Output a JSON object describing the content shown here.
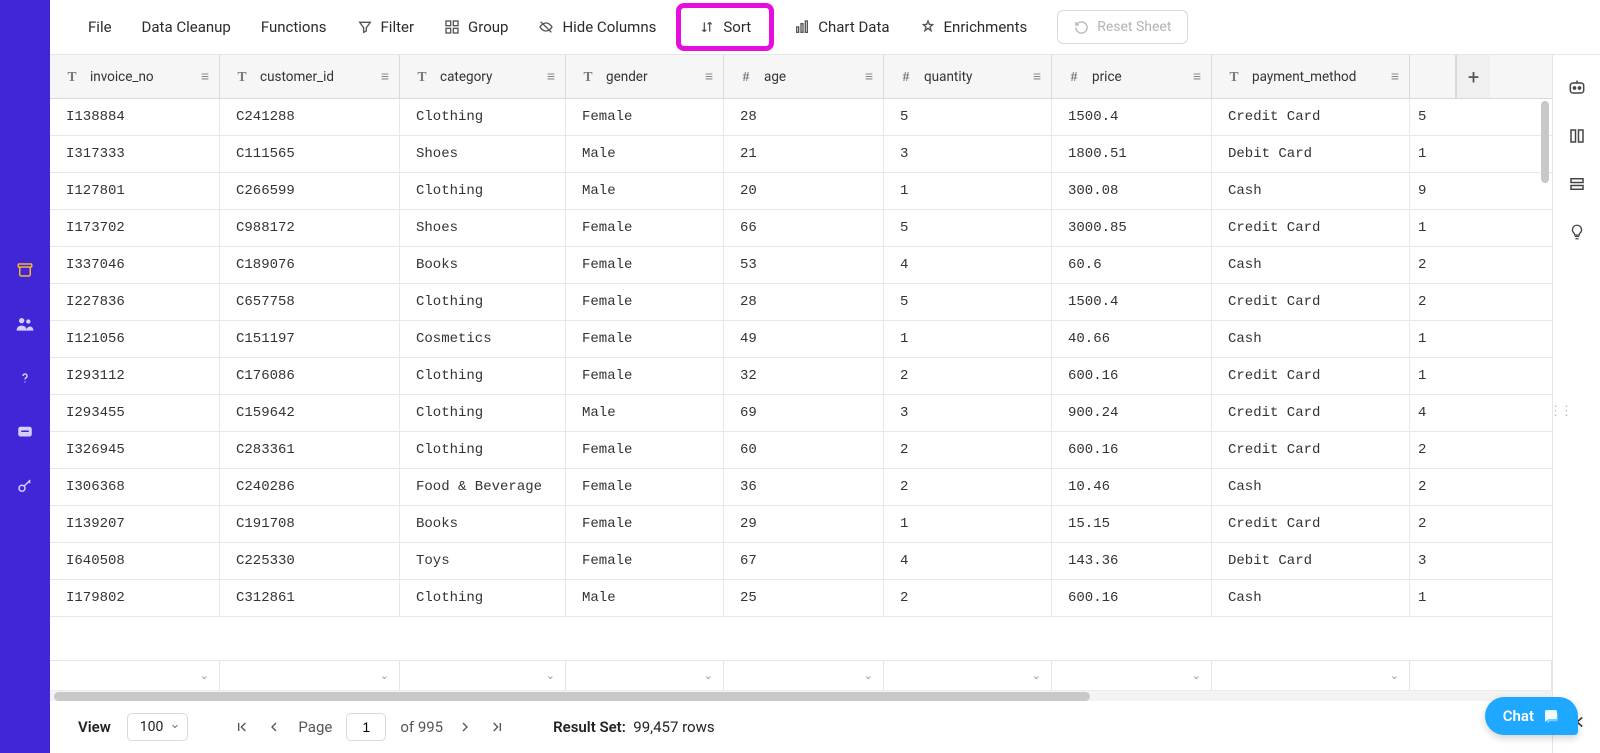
{
  "toolbar": {
    "file": "File",
    "data_cleanup": "Data Cleanup",
    "functions": "Functions",
    "filter": "Filter",
    "group": "Group",
    "hide_columns": "Hide Columns",
    "sort": "Sort",
    "chart_data": "Chart Data",
    "enrichments": "Enrichments",
    "reset_sheet": "Reset Sheet"
  },
  "columns": [
    {
      "name": "invoice_no",
      "type": "text"
    },
    {
      "name": "customer_id",
      "type": "text"
    },
    {
      "name": "category",
      "type": "text"
    },
    {
      "name": "gender",
      "type": "text"
    },
    {
      "name": "age",
      "type": "number"
    },
    {
      "name": "quantity",
      "type": "number"
    },
    {
      "name": "price",
      "type": "number"
    },
    {
      "name": "payment_method",
      "type": "text"
    }
  ],
  "rows": [
    {
      "invoice_no": "I138884",
      "customer_id": "C241288",
      "category": "Clothing",
      "gender": "Female",
      "age": "28",
      "quantity": "5",
      "price": "1500.4",
      "payment_method": "Credit Card",
      "extra": "5"
    },
    {
      "invoice_no": "I317333",
      "customer_id": "C111565",
      "category": "Shoes",
      "gender": "Male",
      "age": "21",
      "quantity": "3",
      "price": "1800.51",
      "payment_method": "Debit Card",
      "extra": "1"
    },
    {
      "invoice_no": "I127801",
      "customer_id": "C266599",
      "category": "Clothing",
      "gender": "Male",
      "age": "20",
      "quantity": "1",
      "price": "300.08",
      "payment_method": "Cash",
      "extra": "9"
    },
    {
      "invoice_no": "I173702",
      "customer_id": "C988172",
      "category": "Shoes",
      "gender": "Female",
      "age": "66",
      "quantity": "5",
      "price": "3000.85",
      "payment_method": "Credit Card",
      "extra": "1"
    },
    {
      "invoice_no": "I337046",
      "customer_id": "C189076",
      "category": "Books",
      "gender": "Female",
      "age": "53",
      "quantity": "4",
      "price": "60.6",
      "payment_method": "Cash",
      "extra": "2"
    },
    {
      "invoice_no": "I227836",
      "customer_id": "C657758",
      "category": "Clothing",
      "gender": "Female",
      "age": "28",
      "quantity": "5",
      "price": "1500.4",
      "payment_method": "Credit Card",
      "extra": "2"
    },
    {
      "invoice_no": "I121056",
      "customer_id": "C151197",
      "category": "Cosmetics",
      "gender": "Female",
      "age": "49",
      "quantity": "1",
      "price": "40.66",
      "payment_method": "Cash",
      "extra": "1"
    },
    {
      "invoice_no": "I293112",
      "customer_id": "C176086",
      "category": "Clothing",
      "gender": "Female",
      "age": "32",
      "quantity": "2",
      "price": "600.16",
      "payment_method": "Credit Card",
      "extra": "1"
    },
    {
      "invoice_no": "I293455",
      "customer_id": "C159642",
      "category": "Clothing",
      "gender": "Male",
      "age": "69",
      "quantity": "3",
      "price": "900.24",
      "payment_method": "Credit Card",
      "extra": "4"
    },
    {
      "invoice_no": "I326945",
      "customer_id": "C283361",
      "category": "Clothing",
      "gender": "Female",
      "age": "60",
      "quantity": "2",
      "price": "600.16",
      "payment_method": "Credit Card",
      "extra": "2"
    },
    {
      "invoice_no": "I306368",
      "customer_id": "C240286",
      "category": "Food & Beverage",
      "gender": "Female",
      "age": "36",
      "quantity": "2",
      "price": "10.46",
      "payment_method": "Cash",
      "extra": "2"
    },
    {
      "invoice_no": "I139207",
      "customer_id": "C191708",
      "category": "Books",
      "gender": "Female",
      "age": "29",
      "quantity": "1",
      "price": "15.15",
      "payment_method": "Credit Card",
      "extra": "2"
    },
    {
      "invoice_no": "I640508",
      "customer_id": "C225330",
      "category": "Toys",
      "gender": "Female",
      "age": "67",
      "quantity": "4",
      "price": "143.36",
      "payment_method": "Debit Card",
      "extra": "3"
    },
    {
      "invoice_no": "I179802",
      "customer_id": "C312861",
      "category": "Clothing",
      "gender": "Male",
      "age": "25",
      "quantity": "2",
      "price": "600.16",
      "payment_method": "Cash",
      "extra": "1"
    }
  ],
  "footer": {
    "view_label": "View",
    "page_size": "100",
    "page_label": "Page",
    "page_value": "1",
    "of_label": "of 995",
    "result_label": "Result Set:",
    "result_value": "99,457 rows"
  },
  "chat_label": "Chat"
}
